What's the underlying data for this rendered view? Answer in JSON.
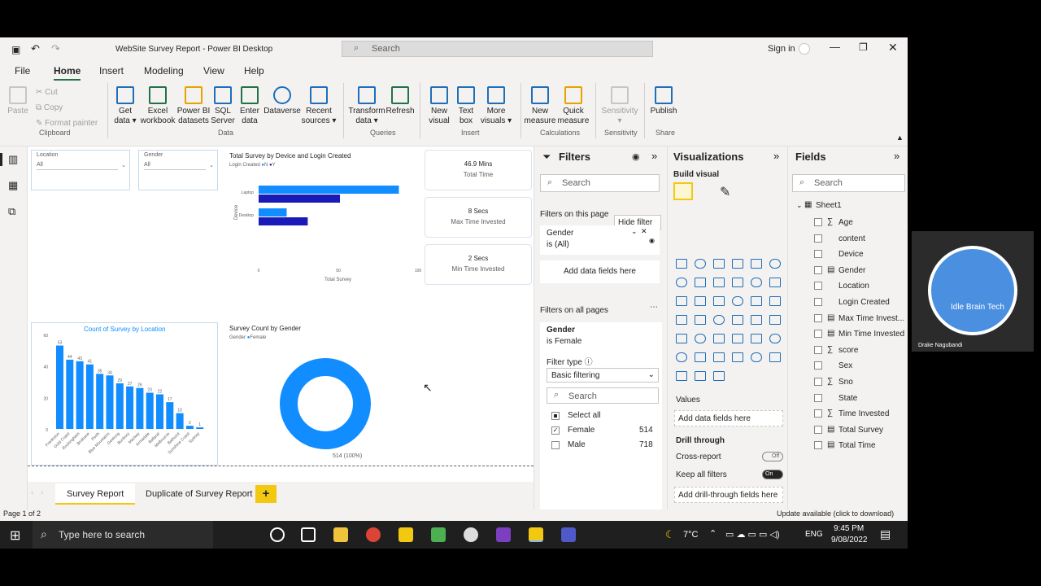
{
  "window": {
    "title": "WebSite Survey Report - Power BI Desktop",
    "search": "Search",
    "sign_in": "Sign in"
  },
  "tabs": [
    "File",
    "Home",
    "Insert",
    "Modeling",
    "View",
    "Help"
  ],
  "ribbon": {
    "clipboard": {
      "paste": "Paste",
      "cut": "Cut",
      "copy": "Copy",
      "format_painter": "Format painter",
      "group": "Clipboard"
    },
    "data": {
      "get_data": [
        "Get",
        "data ▾"
      ],
      "excel": [
        "Excel",
        "workbook"
      ],
      "pbi": [
        "Power BI",
        "datasets"
      ],
      "sql": [
        "SQL",
        "Server"
      ],
      "enter": [
        "Enter",
        "data"
      ],
      "dataverse": "Dataverse",
      "recent": [
        "Recent",
        "sources ▾"
      ],
      "group": "Data"
    },
    "queries": {
      "transform": [
        "Transform",
        "data ▾"
      ],
      "refresh": "Refresh",
      "group": "Queries"
    },
    "insert": {
      "new_visual": [
        "New",
        "visual"
      ],
      "text_box": [
        "Text",
        "box"
      ],
      "more_visuals": [
        "More",
        "visuals ▾"
      ],
      "group": "Insert"
    },
    "calculations": {
      "new_measure": [
        "New",
        "measure"
      ],
      "quick_measure": [
        "Quick",
        "measure"
      ],
      "group": "Calculations"
    },
    "sensitivity": {
      "label": [
        "Sensitivity",
        "▾"
      ],
      "group": "Sensitivity"
    },
    "share": {
      "publish": "Publish",
      "group": "Share"
    }
  },
  "canvas": {
    "slicers": [
      {
        "label": "Location",
        "value": "All"
      },
      {
        "label": "Gender",
        "value": "All"
      }
    ],
    "bar_chart": {
      "title": "Total Survey by Device and Login Created",
      "legend_label": "Login Created",
      "legend_items": [
        "N",
        "Y"
      ],
      "ylabel": "Device",
      "xlabel": "Total Survey",
      "categories": [
        "Laptop",
        "Desktop"
      ],
      "ticks": [
        "0",
        "50",
        "100"
      ]
    },
    "cards": [
      {
        "value": "46.9 Mins",
        "label": "Total Time"
      },
      {
        "value": "8 Secs",
        "label": "Max Time Invested"
      },
      {
        "value": "2 Secs",
        "label": "Min Time Invested"
      }
    ],
    "column_chart": {
      "title": "Count of Survey by Location",
      "yticks": [
        "60",
        "40",
        "20",
        "0"
      ]
    },
    "donut": {
      "title": "Survey Count by Gender",
      "legend_label": "Gender",
      "legend_item": "Female",
      "data_label": "514 (100%)"
    }
  },
  "chart_data": [
    {
      "type": "bar",
      "title": "Total Survey by Device and Login Created",
      "categories": [
        "Laptop",
        "Desktop"
      ],
      "series": [
        {
          "name": "N",
          "values": [
            100,
            20
          ]
        },
        {
          "name": "Y",
          "values": [
            58,
            35
          ]
        }
      ],
      "xlabel": "Total Survey",
      "ylabel": "Device",
      "xlim": [
        0,
        100
      ]
    },
    {
      "type": "bar",
      "title": "Count of Survey by Location",
      "categories": [
        "Frankston",
        "Gold Coast",
        "Rockingham",
        "Brisbane",
        "Perth",
        "Blue Mountains",
        "Geelong",
        "Bunbury",
        "Mackay",
        "Armadale",
        "Ballarat",
        "Melbourne",
        "Bathurst",
        "Sunshine Coast",
        "Sydney"
      ],
      "values": [
        53,
        44,
        43,
        41,
        35,
        34,
        29,
        27,
        26,
        23,
        22,
        17,
        10,
        2,
        1
      ],
      "ylim": [
        0,
        60
      ]
    },
    {
      "type": "pie",
      "title": "Survey Count by Gender",
      "categories": [
        "Female"
      ],
      "values": [
        514
      ]
    }
  ],
  "page_tabs": [
    "Survey Report",
    "Duplicate of Survey Report"
  ],
  "filters": {
    "title": "Filters",
    "search": "Search",
    "on_page": "Filters on this page",
    "hide_filter": "Hide filter",
    "page_filter": {
      "field": "Gender",
      "value": "is (All)"
    },
    "add_fields": "Add data fields here",
    "all_pages": "Filters on all pages",
    "gender_card": {
      "field": "Gender",
      "value": "is Female",
      "filter_type_label": "Filter type ⓘ",
      "filter_type": "Basic filtering",
      "search": "Search",
      "select_all": "Select all",
      "items": [
        {
          "label": "Female",
          "count": "514",
          "checked": true
        },
        {
          "label": "Male",
          "count": "718",
          "checked": false
        }
      ]
    }
  },
  "visualizations": {
    "title": "Visualizations",
    "build_visual": "Build visual",
    "values": "Values",
    "add_fields": "Add data fields here",
    "drill_through": "Drill through",
    "cross_report": "Cross-report",
    "cross_report_state": "Off",
    "keep_all": "Keep all filters",
    "keep_all_state": "On",
    "add_drill": "Add drill-through fields here"
  },
  "fields": {
    "title": "Fields",
    "search": "Search",
    "table": "Sheet1",
    "items": [
      {
        "label": "Age",
        "prefix": "∑"
      },
      {
        "label": "content",
        "prefix": ""
      },
      {
        "label": "Device",
        "prefix": ""
      },
      {
        "label": "Gender",
        "prefix": "▤"
      },
      {
        "label": "Location",
        "prefix": ""
      },
      {
        "label": "Login Created",
        "prefix": ""
      },
      {
        "label": "Max Time Invest...",
        "prefix": "▤"
      },
      {
        "label": "Min Time Invested",
        "prefix": "▤"
      },
      {
        "label": "score",
        "prefix": "∑"
      },
      {
        "label": "Sex",
        "prefix": ""
      },
      {
        "label": "Sno",
        "prefix": "∑"
      },
      {
        "label": "State",
        "prefix": ""
      },
      {
        "label": "Time Invested",
        "prefix": "∑"
      },
      {
        "label": "Total Survey",
        "prefix": "▤"
      },
      {
        "label": "Total Time",
        "prefix": "▤"
      }
    ]
  },
  "status": {
    "page": "Page 1 of 2",
    "update": "Update available (click to download)"
  },
  "taskbar": {
    "search": "Type here to search",
    "weather": "7°C",
    "lang": "ENG",
    "time": "9:45 PM",
    "date": "9/08/2022"
  },
  "webcam": {
    "logo_text": "Idle Brain Tech",
    "name": "Drake Nagubandi"
  },
  "colors": {
    "bar_dark": "#1a1ab8",
    "bar_light": "#118dff",
    "accent": "#217346"
  }
}
